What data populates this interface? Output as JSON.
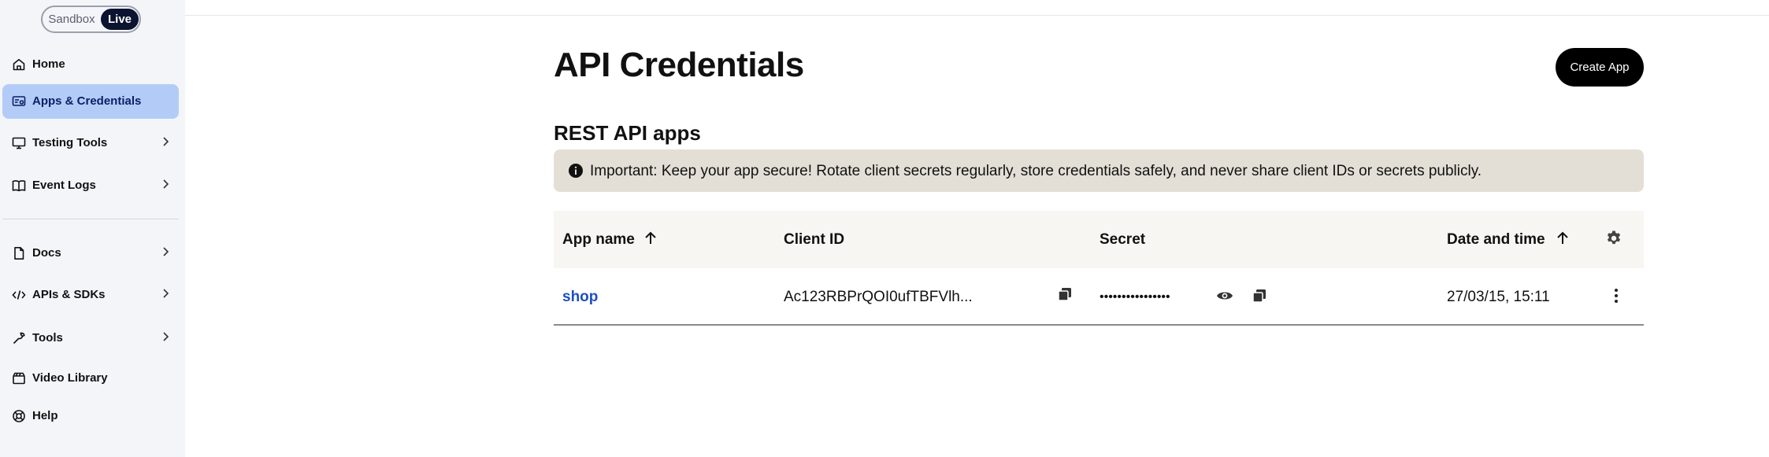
{
  "env_toggle": {
    "sandbox": "Sandbox",
    "live": "Live",
    "selected": "Live"
  },
  "sidebar": {
    "items": [
      {
        "label": "Home",
        "icon": "home-icon",
        "active": false,
        "chevron": false
      },
      {
        "label": "Apps & Credentials",
        "icon": "credentials-icon",
        "active": true,
        "chevron": false
      },
      {
        "label": "Testing Tools",
        "icon": "monitor-icon",
        "active": false,
        "chevron": true
      },
      {
        "label": "Event Logs",
        "icon": "book-icon",
        "active": false,
        "chevron": true
      },
      {
        "label": "Docs",
        "icon": "document-icon",
        "active": false,
        "chevron": true
      },
      {
        "label": "APIs & SDKs",
        "icon": "code-icon",
        "active": false,
        "chevron": true
      },
      {
        "label": "Tools",
        "icon": "wrench-icon",
        "active": false,
        "chevron": true
      },
      {
        "label": "Video Library",
        "icon": "video-icon",
        "active": false,
        "chevron": false
      },
      {
        "label": "Help",
        "icon": "lifebuoy-icon",
        "active": false,
        "chevron": false
      }
    ]
  },
  "main": {
    "title": "API Credentials",
    "create_button": "Create App",
    "section_title": "REST API apps",
    "banner": {
      "icon": "info-icon",
      "text": "Important: Keep your app secure! Rotate client secrets regularly, store credentials safely, and never share client IDs or secrets publicly."
    },
    "table": {
      "columns": [
        "App name",
        "Client ID",
        "Secret",
        "Date and time"
      ],
      "rows": [
        {
          "app_name": "shop",
          "client_id": "Ac123RBPrQOI0ufTBFVlh...",
          "secret": "••••••••••••••••",
          "date_time": "27/03/15, 15:11"
        }
      ]
    }
  },
  "colors": {
    "sidebar_bg": "#f4f5f9",
    "active_item_bg": "#b3ccf7",
    "banner_bg": "#e4dfd6",
    "link": "#1b4fc4",
    "toggle_selected": "#0b1330"
  }
}
